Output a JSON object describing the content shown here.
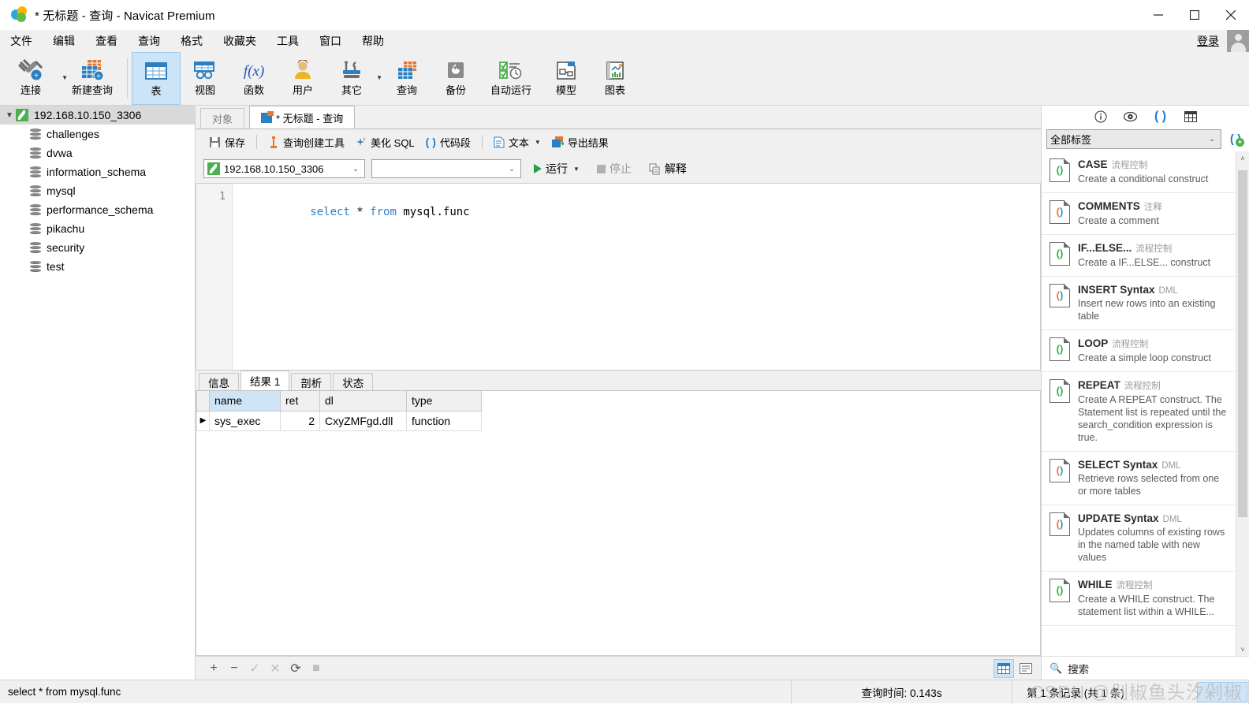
{
  "window": {
    "title": "* 无标题 - 查询 - Navicat Premium",
    "minimize": "–",
    "maximize": "□",
    "close": "✕"
  },
  "menubar": {
    "items": [
      "文件",
      "编辑",
      "查看",
      "查询",
      "格式",
      "收藏夹",
      "工具",
      "窗口",
      "帮助"
    ],
    "login_label": "登录"
  },
  "ribbon": {
    "items": [
      {
        "label": "连接",
        "icon": "connection-icon",
        "caret": true
      },
      {
        "label": "新建查询",
        "icon": "new-query-icon",
        "caret": false
      },
      {
        "label": "表",
        "icon": "table-icon",
        "caret": false,
        "selected": true
      },
      {
        "label": "视图",
        "icon": "view-icon",
        "caret": false
      },
      {
        "label": "函数",
        "icon": "function-icon",
        "caret": false
      },
      {
        "label": "用户",
        "icon": "user-icon",
        "caret": false
      },
      {
        "label": "其它",
        "icon": "other-tools-icon",
        "caret": true
      },
      {
        "label": "查询",
        "icon": "query-icon",
        "caret": false
      },
      {
        "label": "备份",
        "icon": "backup-icon",
        "caret": false
      },
      {
        "label": "自动运行",
        "icon": "automation-icon",
        "caret": false
      },
      {
        "label": "模型",
        "icon": "model-icon",
        "caret": false
      },
      {
        "label": "图表",
        "icon": "chart-icon",
        "caret": false
      }
    ]
  },
  "sidebar": {
    "root": {
      "label": "192.168.10.150_3306",
      "expanded": true
    },
    "databases": [
      "challenges",
      "dvwa",
      "information_schema",
      "mysql",
      "performance_schema",
      "pikachu",
      "security",
      "test"
    ]
  },
  "tabs": [
    {
      "label": "对象",
      "active": false
    },
    {
      "label": "* 无标题 - 查询",
      "active": true
    }
  ],
  "query_toolbar": {
    "save": "保存",
    "query_builder": "查询创建工具",
    "beautify_sql": "美化 SQL",
    "code_snippet": "代码段",
    "text": "文本",
    "export_result": "导出结果"
  },
  "query_run": {
    "connection": "192.168.10.150_3306",
    "database": "",
    "run": "运行",
    "stop": "停止",
    "explain": "解释"
  },
  "editor": {
    "line_number": "1",
    "sql_tokens": [
      {
        "t": "select",
        "c": "kw"
      },
      {
        "t": " * ",
        "c": "op"
      },
      {
        "t": "from",
        "c": "kw"
      },
      {
        "t": " mysql.func",
        "c": "id"
      }
    ],
    "sql_plain": "select * from mysql.func"
  },
  "result_tabs": [
    {
      "label": "信息",
      "active": false
    },
    {
      "label": "结果 1",
      "active": true
    },
    {
      "label": "剖析",
      "active": false
    },
    {
      "label": "状态",
      "active": false
    }
  ],
  "result_grid": {
    "columns": [
      "name",
      "ret",
      "dl",
      "type"
    ],
    "selected_column": "name",
    "rows": [
      {
        "marker": "▶",
        "name": "sys_exec",
        "ret": "2",
        "dl": "CxyZMFgd.dll",
        "type": "function"
      }
    ]
  },
  "grid_toolbar": {
    "add": "+",
    "remove": "−",
    "confirm": "✓",
    "cancel": "✕",
    "refresh": "⟳",
    "stop": "■",
    "view_grid": "grid-view-icon",
    "view_form": "form-view-icon"
  },
  "right_panel": {
    "tab_icons": [
      "info-icon",
      "eye-icon",
      "code-snippet-icon",
      "table-grid-icon"
    ],
    "filter_value": "全部标签",
    "add_snippet": "add-snippet-icon",
    "search_placeholder": "搜索",
    "snippets": [
      {
        "title": "CASE",
        "tag": "流程控制",
        "desc": "Create a conditional construct",
        "color": "green"
      },
      {
        "title": "COMMENTS",
        "tag": "注释",
        "desc": "Create a comment",
        "color": "orange"
      },
      {
        "title": "IF...ELSE...",
        "tag": "流程控制",
        "desc": "Create a IF...ELSE... construct",
        "color": "green"
      },
      {
        "title": "INSERT Syntax",
        "tag": "DML",
        "desc": "Insert new rows into an existing table",
        "color": "orange"
      },
      {
        "title": "LOOP",
        "tag": "流程控制",
        "desc": "Create a simple loop construct",
        "color": "green"
      },
      {
        "title": "REPEAT",
        "tag": "流程控制",
        "desc": "Create A REPEAT construct. The Statement list is repeated until the search_condition expression is true.",
        "color": "green"
      },
      {
        "title": "SELECT Syntax",
        "tag": "DML",
        "desc": "Retrieve rows selected from one or more tables",
        "color": "orange"
      },
      {
        "title": "UPDATE Syntax",
        "tag": "DML",
        "desc": "Updates columns of existing rows in the named table with new values",
        "color": "orange"
      },
      {
        "title": "WHILE",
        "tag": "流程控制",
        "desc": "Create a WHILE construct. The statement list within a WHILE...",
        "color": "green"
      }
    ]
  },
  "statusbar": {
    "sql": "select * from mysql.func",
    "query_time": "查询时间: 0.143s",
    "record_info": "第 1 条记录 (共 1 条)",
    "watermark": "CSDN @剁椒鱼头汐剁椒"
  },
  "colors": {
    "accent": "#2c7fc0",
    "selection": "#cce4f7",
    "green": "#23a047",
    "orange": "#e8772e"
  }
}
